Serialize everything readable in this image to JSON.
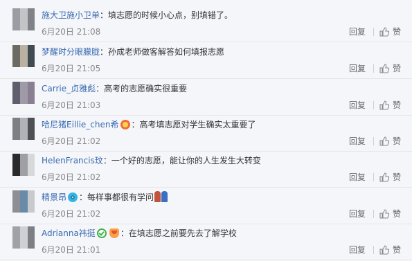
{
  "comments": [
    {
      "user": "施大卫施小卫单",
      "separator": "：",
      "text": "填志愿的时候小心点，别填错了。",
      "badges": [],
      "time": "6月20日 21:08",
      "reply": "回复",
      "like": "赞",
      "avatar_colors": [
        "#9a9da3",
        "#c2c4c8",
        "#7f8287"
      ]
    },
    {
      "user": "梦醒时分眼朦胧",
      "separator": "：",
      "text": "孙成老师做客解答如何填报志愿",
      "badges": [],
      "time": "6月20日 21:05",
      "reply": "回复",
      "like": "赞",
      "avatar_colors": [
        "#6b6a63",
        "#b9b2a3",
        "#3f4a52"
      ]
    },
    {
      "user": "Carrie_贞雅彪",
      "separator": "：",
      "text": "高考的志愿确实很重要",
      "badges": [],
      "time": "6月20日 21:03",
      "reply": "回复",
      "like": "赞",
      "avatar_colors": [
        "#5e5e6e",
        "#a09aa8",
        "#8a7f92"
      ]
    },
    {
      "user": "哈尼猪Eillie_chen希",
      "separator": "：",
      "text": "高考填志愿对学生确实太重要了",
      "badges": [
        "fire"
      ],
      "time": "6月20日 21:02",
      "reply": "回复",
      "like": "赞",
      "avatar_colors": [
        "#7d7f84",
        "#b0b2b6",
        "#4d4f55"
      ]
    },
    {
      "user": "HelenFrancis玟",
      "separator": "：",
      "text": "一个好的志愿，能让你的人生发生大转变",
      "badges": [],
      "time": "6月20日 21:02",
      "reply": "回复",
      "like": "赞",
      "avatar_colors": [
        "#2a2a2c",
        "#9ea0a4",
        "#d7d8da"
      ]
    },
    {
      "user": "精景昂",
      "separator": "：",
      "text": "每样事都很有学问",
      "badges": [
        "eye"
      ],
      "emoji_after": true,
      "time": "6月20日 21:02",
      "reply": "回复",
      "like": "赞",
      "avatar_colors": [
        "#8d8f94",
        "#6a8aa8",
        "#c8c9cc"
      ]
    },
    {
      "user": "Adrianna祎挺",
      "separator": "：",
      "text": "在填志愿之前要先去了解学校",
      "badges": [
        "vip",
        "slice"
      ],
      "time": "6月20日 21:01",
      "reply": "回复",
      "like": "赞",
      "avatar_colors": [
        "#a0a2a6",
        "#cfd0d3",
        "#7c7f84"
      ]
    }
  ]
}
